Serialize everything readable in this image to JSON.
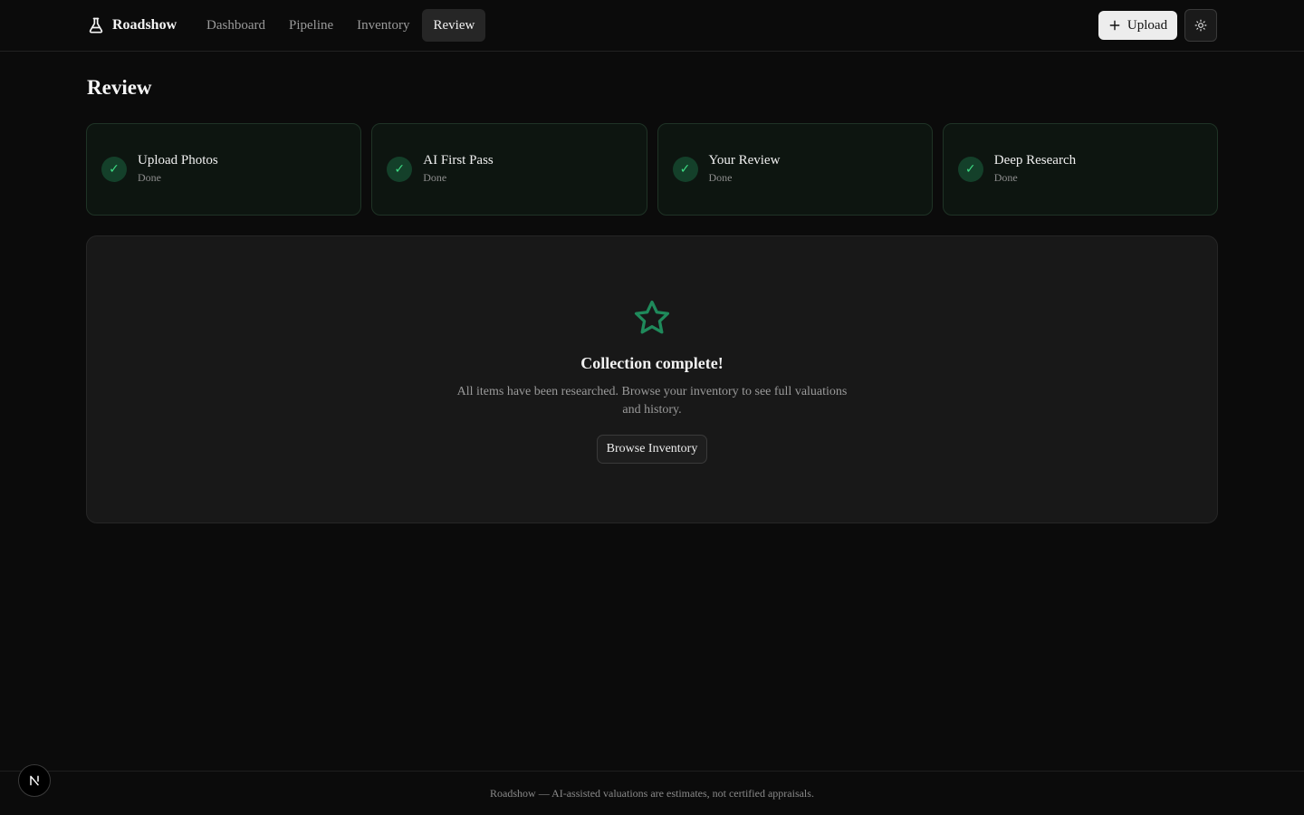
{
  "brand": {
    "name": "Roadshow",
    "icon": "flask-icon"
  },
  "nav": {
    "items": [
      {
        "label": "Dashboard",
        "active": false
      },
      {
        "label": "Pipeline",
        "active": false
      },
      {
        "label": "Inventory",
        "active": false
      },
      {
        "label": "Review",
        "active": true
      }
    ]
  },
  "header": {
    "upload_label": "Upload",
    "upload_icon": "plus-icon",
    "theme_icon": "sun-icon"
  },
  "page": {
    "title": "Review"
  },
  "steps": [
    {
      "title": "Upload Photos",
      "status": "Done"
    },
    {
      "title": "AI First Pass",
      "status": "Done"
    },
    {
      "title": "Your Review",
      "status": "Done"
    },
    {
      "title": "Deep Research",
      "status": "Done"
    }
  ],
  "complete": {
    "icon": "star-icon",
    "title": "Collection complete!",
    "description": "All items have been researched. Browse your inventory to see full valuations and history.",
    "button_label": "Browse Inventory"
  },
  "footer": {
    "text": "Roadshow — AI-assisted valuations are estimates, not certified appraisals."
  },
  "colors": {
    "background": "#0b0b0b",
    "accent_green": "#3ddc84",
    "star_green": "#1f8a5b"
  }
}
